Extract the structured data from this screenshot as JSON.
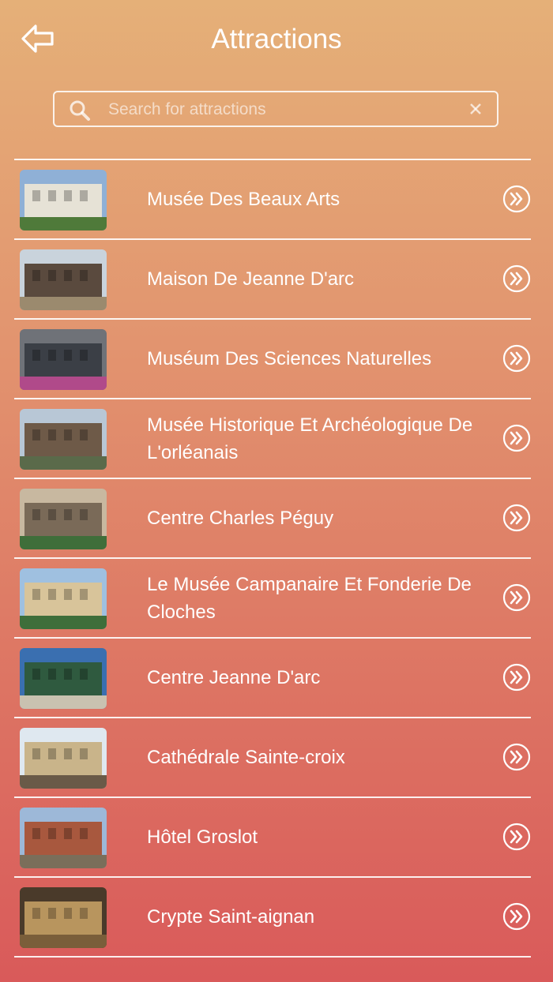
{
  "header": {
    "title": "Attractions",
    "back_icon": "back-arrow-icon"
  },
  "search": {
    "placeholder": "Search for attractions",
    "value": "",
    "icon": "search-icon",
    "clear_icon": "close-icon"
  },
  "attractions": [
    {
      "name": "Musée Des Beaux Arts",
      "thumb": [
        "#8fb0d6",
        "#e6e2d6",
        "#4f7a3a"
      ]
    },
    {
      "name": "Maison De Jeanne D'arc",
      "thumb": [
        "#c9d3dc",
        "#5a4a3e",
        "#9b8a6e"
      ]
    },
    {
      "name": "Muséum Des Sciences Naturelles",
      "thumb": [
        "#6f7278",
        "#3b3f46",
        "#b04a8a"
      ]
    },
    {
      "name": "Musée Historique Et Archéologique De L'orléanais",
      "thumb": [
        "#b8c7d6",
        "#6e5a48",
        "#5a6a4a"
      ]
    },
    {
      "name": "Centre Charles Péguy",
      "thumb": [
        "#c8b8a0",
        "#7a6a58",
        "#3f6e3a"
      ]
    },
    {
      "name": "Le Musée Campanaire Et Fonderie De Cloches",
      "thumb": [
        "#9fc0e0",
        "#d8c49a",
        "#3e6e3a"
      ]
    },
    {
      "name": "Centre Jeanne D'arc",
      "thumb": [
        "#3a6fb0",
        "#2f5a3f",
        "#c9c2b0"
      ]
    },
    {
      "name": "Cathédrale Sainte-croix",
      "thumb": [
        "#dfe8f0",
        "#c9b48a",
        "#6a5a48"
      ]
    },
    {
      "name": "Hôtel Groslot",
      "thumb": [
        "#9db8d8",
        "#a8583e",
        "#7a6e5a"
      ]
    },
    {
      "name": "Crypte Saint-aignan",
      "thumb": [
        "#4a3a2a",
        "#b8955e",
        "#7a5e3a"
      ]
    }
  ]
}
